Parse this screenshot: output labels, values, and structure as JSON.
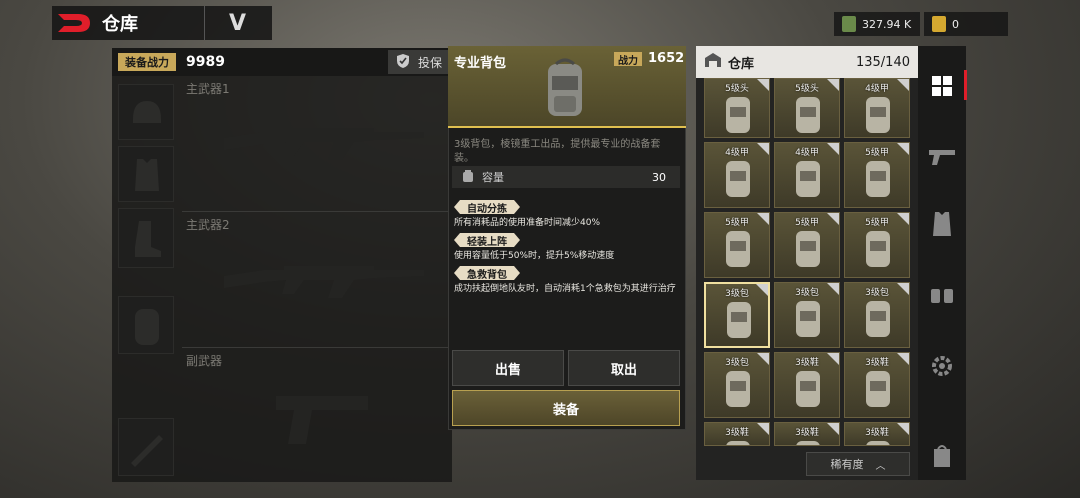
{
  "header": {
    "title": "仓库",
    "dropdown_label": "V"
  },
  "currency": {
    "cash": "327.94 K",
    "gold": "0"
  },
  "loadout": {
    "power_label": "装备战力",
    "power_value": "9989",
    "insure_label": "投保",
    "primary1_label": "主武器1",
    "primary2_label": "主武器2",
    "secondary_label": "副武器"
  },
  "detail": {
    "name": "专业背包",
    "power_label": "战力",
    "power_value": "1652",
    "description": "3级背包，棱镜重工出品，提供最专业的战备套装。",
    "capacity_label": "容量",
    "capacity_value": "30",
    "perks": [
      {
        "tag": "自动分拣",
        "text": "所有消耗品的使用准备时间减少40%"
      },
      {
        "tag": "轻装上阵",
        "text": "使用容量低于50%时，提升5%移动速度"
      },
      {
        "tag": "急救背包",
        "text": "成功扶起倒地队友时，自动消耗1个急救包为其进行治疗"
      }
    ],
    "sell_label": "出售",
    "take_label": "取出",
    "equip_label": "装备"
  },
  "warehouse": {
    "title": "仓库",
    "count": "135/140",
    "sort_label": "稀有度",
    "cells": [
      {
        "label": "5级头"
      },
      {
        "label": "5级头"
      },
      {
        "label": "4级甲"
      },
      {
        "label": "4级甲"
      },
      {
        "label": "4级甲"
      },
      {
        "label": "5级甲"
      },
      {
        "label": "5级甲"
      },
      {
        "label": "5级甲"
      },
      {
        "label": "5级甲"
      },
      {
        "label": "3级包"
      },
      {
        "label": "3级包"
      },
      {
        "label": "3级包"
      },
      {
        "label": "3级包"
      },
      {
        "label": "3级鞋"
      },
      {
        "label": "3级鞋"
      },
      {
        "label": "3级鞋"
      },
      {
        "label": "3级鞋"
      },
      {
        "label": "3级鞋"
      }
    ]
  },
  "colors": {
    "accent": "#e0c050",
    "tag_gold": "#c8a85a",
    "logo_red": "#e01e2a"
  }
}
